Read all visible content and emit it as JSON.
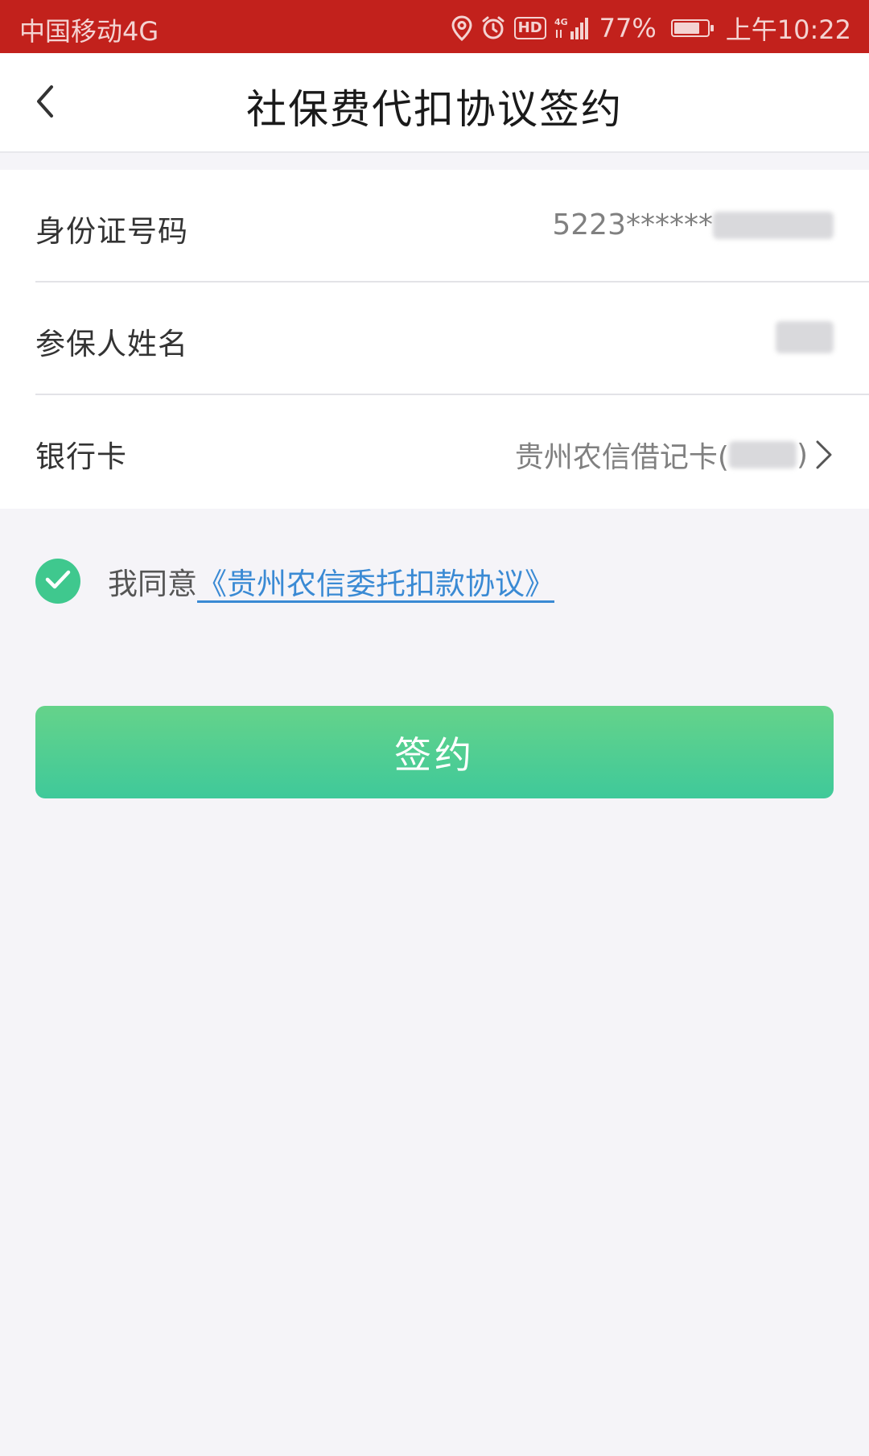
{
  "status_bar": {
    "carrier": "中国移动4G",
    "network_label": "4G",
    "hd_badge": "HD",
    "battery_percent": "77%",
    "battery_level": 0.77,
    "time": "上午10:22",
    "icons": [
      "location-icon",
      "alarm-icon",
      "hd-icon",
      "signal-icon",
      "battery-icon"
    ],
    "background_color": "#c2211c"
  },
  "header": {
    "title": "社保费代扣协议签约",
    "back_icon": "chevron-left-icon"
  },
  "form": {
    "id_number": {
      "label": "身份证号码",
      "value_visible": "5223******"
    },
    "insured_name": {
      "label": "参保人姓名"
    },
    "bank_card": {
      "label": "银行卡",
      "value_prefix": "贵州农信借记卡(",
      "value_suffix": ")",
      "icon": "chevron-right-icon"
    }
  },
  "agreement": {
    "checked": true,
    "prefix": "我同意",
    "link_text": "《贵州农信委托扣款协议》",
    "check_color": "#3fc88e",
    "link_color": "#3a8ad4"
  },
  "sign_button": {
    "label": "签约",
    "color_top": "#65d38a",
    "color_bottom": "#3fc99a"
  }
}
